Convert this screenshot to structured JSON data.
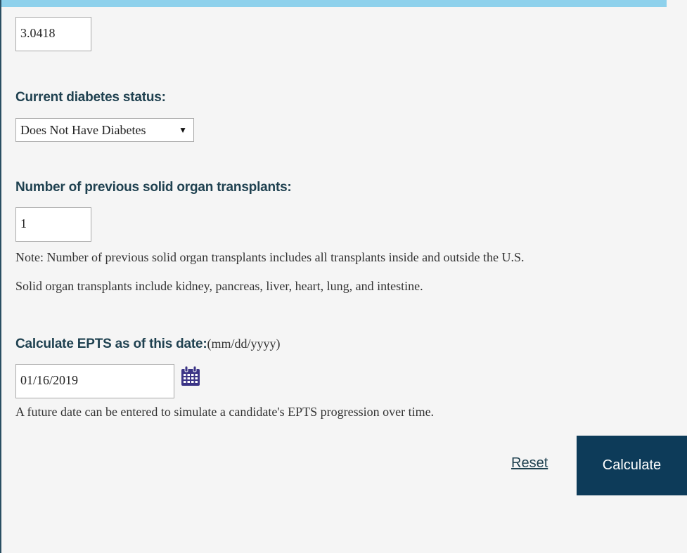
{
  "fields": {
    "previous_value": "3.0418",
    "diabetes": {
      "label": "Current diabetes status:",
      "selected": "Does Not Have Diabetes",
      "arrow": "▼"
    },
    "transplants": {
      "label": "Number of previous solid organ transplants:",
      "value": "1",
      "note_line1": "Note: Number of previous solid organ transplants includes all transplants inside and outside the U.S.",
      "note_line2": "Solid organ transplants include kidney, pancreas, liver, heart, lung, and intestine."
    },
    "date": {
      "label": "Calculate EPTS as of this date:",
      "format_hint": "(mm/dd/yyyy)",
      "value": "01/16/2019",
      "icon": "calendar-icon",
      "note": "A future date can be entered to simulate a candidate's EPTS progression over time."
    }
  },
  "actions": {
    "reset_label": "Reset",
    "calculate_label": "Calculate"
  },
  "colors": {
    "top_band": "#8ed1ec",
    "label_text": "#1f4150",
    "calculate_bg": "#0d3b59",
    "calendar_icon": "#3b3486",
    "page_bg": "#f5f5f5"
  }
}
